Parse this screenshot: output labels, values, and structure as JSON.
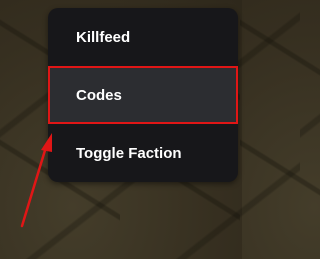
{
  "menu": {
    "items": [
      {
        "label": "Killfeed",
        "selected": false
      },
      {
        "label": "Codes",
        "selected": true
      },
      {
        "label": "Toggle Faction",
        "selected": false
      }
    ]
  },
  "colors": {
    "menu_background": "#17171a",
    "selected_background": "#2c2d31",
    "highlight": "#e01616",
    "text": "#ffffff"
  },
  "annotation": {
    "arrow_icon": "arrow-up-right-icon"
  }
}
